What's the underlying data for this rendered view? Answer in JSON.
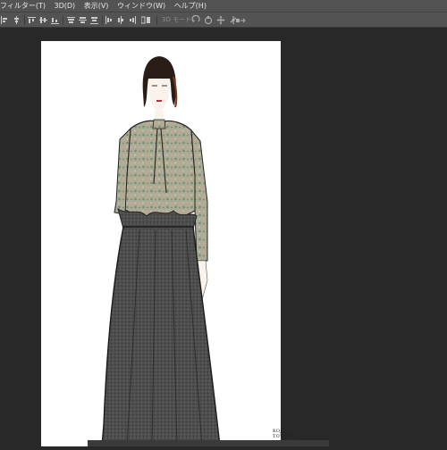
{
  "menubar": {
    "items": [
      "フィルター(T)",
      "3D(D)",
      "表示(V)",
      "ウィンドウ(W)",
      "ヘルプ(H)"
    ]
  },
  "options_bar": {
    "mode_3d_label": "3D モード：",
    "icons": [
      "align-left-edges-icon",
      "align-horizontal-centers-icon",
      "align-right-edges-icon",
      "distribute-top-icon",
      "distribute-vertical-centers-icon",
      "distribute-bottom-icon",
      "distribute-left-icon",
      "distribute-horizontal-centers-icon",
      "distribute-right-icon",
      "auto-align-layers-icon",
      "rotate-3d-icon",
      "roll-3d-icon",
      "pan-3d-icon",
      "slide-3d-icon",
      "scale-3d-icon"
    ]
  },
  "document": {
    "artwork": "fashion illustration of a woman in floral blouse and long dark skirt",
    "signature": "KOJI TOYODA",
    "background_color": "#ffffff"
  },
  "colors": {
    "panel": "#535353",
    "workspace": "#282828"
  }
}
